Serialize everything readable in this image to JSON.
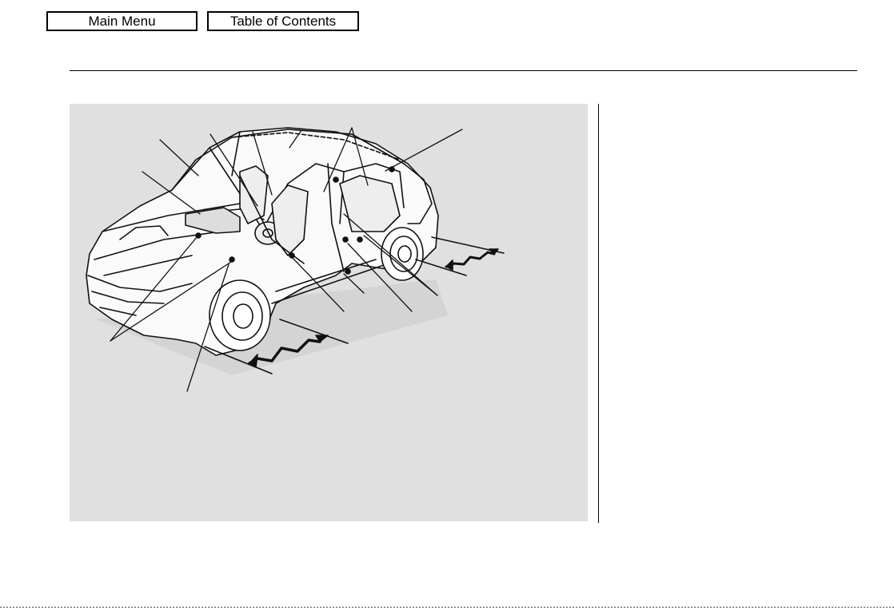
{
  "nav": {
    "main_menu": "Main Menu",
    "table_of_contents": "Table of Contents"
  }
}
